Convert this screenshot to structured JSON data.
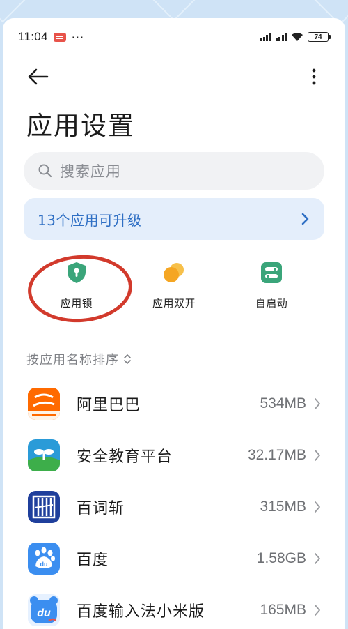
{
  "status_bar": {
    "time": "11:04",
    "dots": "···",
    "battery": "74"
  },
  "page": {
    "title": "应用设置"
  },
  "search": {
    "placeholder": "搜索应用"
  },
  "upgrade_banner": {
    "label": "13个应用可升级"
  },
  "features": [
    {
      "label": "应用锁",
      "icon": "shield-lock-icon",
      "color": "#3aa57a"
    },
    {
      "label": "应用双开",
      "icon": "dual-app-icon",
      "color": "#f5a623"
    },
    {
      "label": "自启动",
      "icon": "autostart-icon",
      "color": "#3aa57a"
    }
  ],
  "sort": {
    "label": "按应用名称排序"
  },
  "apps": [
    {
      "name": "阿里巴巴",
      "size": "534MB",
      "icon": "alibaba-1688-icon"
    },
    {
      "name": "安全教育平台",
      "size": "32.17MB",
      "icon": "safety-education-icon"
    },
    {
      "name": "百词斩",
      "size": "315MB",
      "icon": "baicizhan-icon"
    },
    {
      "name": "百度",
      "size": "1.58GB",
      "icon": "baidu-icon"
    },
    {
      "name": "百度输入法小米版",
      "size": "165MB",
      "icon": "baidu-input-icon"
    }
  ],
  "colors": {
    "accent": "#2f6fc4",
    "banner_bg": "#e4eefb",
    "annotation_circle": "#d23a2c",
    "frame_bg": "#cfe3f6"
  }
}
